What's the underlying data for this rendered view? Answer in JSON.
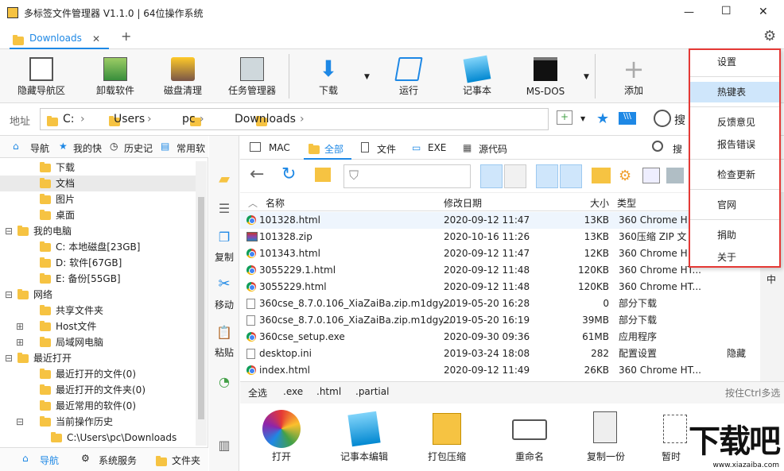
{
  "window": {
    "title": "多标签文件管理器 V1.1.0 | 64位操作系统",
    "min": "—",
    "max": "☐",
    "close": "✕"
  },
  "tabs": [
    {
      "label": "Downloads",
      "close": "✕"
    }
  ],
  "tab_add": "+",
  "toolbar": [
    {
      "label": "隐藏导航区",
      "icon": "hide-nav-icon"
    },
    {
      "label": "卸载软件",
      "icon": "uninstall-icon"
    },
    {
      "label": "磁盘清理",
      "icon": "disk-clean-icon"
    },
    {
      "label": "任务管理器",
      "icon": "task-manager-icon"
    },
    {
      "label": "下载",
      "icon": "download-icon"
    },
    {
      "label": "运行",
      "icon": "run-icon"
    },
    {
      "label": "记事本",
      "icon": "notepad-icon"
    },
    {
      "label": "MS-DOS",
      "icon": "cmd-icon"
    },
    {
      "label": "添加",
      "icon": "add-icon"
    }
  ],
  "address": {
    "label": "地址",
    "crumbs": [
      "C:",
      "Users",
      "pc",
      "Downloads"
    ],
    "search": "搜"
  },
  "left_tabs": [
    "导航",
    "我的快",
    "历史记",
    "常用软"
  ],
  "tree": [
    {
      "label": "下载",
      "indent": 2
    },
    {
      "label": "文档",
      "indent": 2
    },
    {
      "label": "图片",
      "indent": 2
    },
    {
      "label": "桌面",
      "indent": 2
    },
    {
      "label": "我的电脑",
      "indent": 0,
      "toggle": "⊟"
    },
    {
      "label": "C: 本地磁盘[23GB]",
      "indent": 2
    },
    {
      "label": "D: 软件[67GB]",
      "indent": 2
    },
    {
      "label": "E: 备份[55GB]",
      "indent": 2
    },
    {
      "label": "网络",
      "indent": 0,
      "toggle": "⊟"
    },
    {
      "label": "共享文件夹",
      "indent": 2
    },
    {
      "label": "Host文件",
      "indent": 2,
      "toggle": "⊞"
    },
    {
      "label": "局域网电脑",
      "indent": 2,
      "toggle": "⊞"
    },
    {
      "label": "最近打开",
      "indent": 0,
      "toggle": "⊟"
    },
    {
      "label": "最近打开的文件(0)",
      "indent": 2
    },
    {
      "label": "最近打开的文件夹(0)",
      "indent": 2
    },
    {
      "label": "最近常用的软件(0)",
      "indent": 2
    },
    {
      "label": "当前操作历史",
      "indent": 2,
      "toggle": "⊟"
    },
    {
      "label": "C:\\Users\\pc\\Downloads",
      "indent": 3
    }
  ],
  "bottom_tabs": [
    "导航",
    "系统服务",
    "文件夹"
  ],
  "side": [
    "复制",
    "移动",
    "粘贴"
  ],
  "file_tabs": [
    "MAC",
    "全部",
    "文件",
    "EXE",
    "源代码"
  ],
  "file_search": "搜",
  "columns": {
    "name": "名称",
    "date": "修改日期",
    "size": "大小",
    "type": "类型"
  },
  "files": [
    {
      "name": "101328.html",
      "date": "2020-09-12 11:47",
      "size": "13KB",
      "type": "360 Chrome H",
      "icon": "chrome"
    },
    {
      "name": "101328.zip",
      "date": "2020-10-16 11:26",
      "size": "13KB",
      "type": "360压缩 ZIP 文",
      "icon": "zip"
    },
    {
      "name": "101343.html",
      "date": "2020-09-12 11:47",
      "size": "12KB",
      "type": "360 Chrome H",
      "icon": "chrome"
    },
    {
      "name": "3055229.1.html",
      "date": "2020-09-12 11:48",
      "size": "120KB",
      "type": "360 Chrome HT...",
      "icon": "chrome"
    },
    {
      "name": "3055229.html",
      "date": "2020-09-12 11:48",
      "size": "120KB",
      "type": "360 Chrome HT...",
      "icon": "chrome"
    },
    {
      "name": "360cse_8.7.0.106_XiaZaiBa.zip.m1dgy...",
      "date": "2019-05-20 16:28",
      "size": "0",
      "type": "部分下载",
      "icon": "doc"
    },
    {
      "name": "360cse_8.7.0.106_XiaZaiBa.zip.m1dgy...",
      "date": "2019-05-20 16:19",
      "size": "39MB",
      "type": "部分下载",
      "icon": "doc"
    },
    {
      "name": "360cse_setup.exe",
      "date": "2020-09-30 09:36",
      "size": "61MB",
      "type": "应用程序",
      "icon": "chrome"
    },
    {
      "name": "desktop.ini",
      "date": "2019-03-24 18:08",
      "size": "282",
      "type": "配置设置",
      "icon": "doc",
      "extra": "隐藏"
    },
    {
      "name": "index.html",
      "date": "2020-09-12 11:49",
      "size": "26KB",
      "type": "360 Chrome HT...",
      "icon": "chrome"
    }
  ],
  "side_right": "中",
  "filters": [
    "全选",
    ".exe",
    ".html",
    ".partial"
  ],
  "filter_hint": "按住Ctrl多选",
  "actions": [
    "打开",
    "记事本编辑",
    "打包压缩",
    "重命名",
    "复制一份",
    "暂时"
  ],
  "menu": [
    {
      "label": "设置"
    },
    {
      "label": "热键表",
      "highlight": true
    },
    {
      "label": "反馈意见"
    },
    {
      "label": "报告错误"
    },
    {
      "label": "检查更新"
    },
    {
      "label": "官网"
    },
    {
      "label": "捐助"
    },
    {
      "label": "关于"
    }
  ],
  "watermark": {
    "text": "下载吧",
    "sub": "www.xiazaiba.com"
  },
  "colors": {
    "accent": "#1e88e5",
    "menu_border": "#e53935",
    "highlight": "#cfe6fb"
  }
}
